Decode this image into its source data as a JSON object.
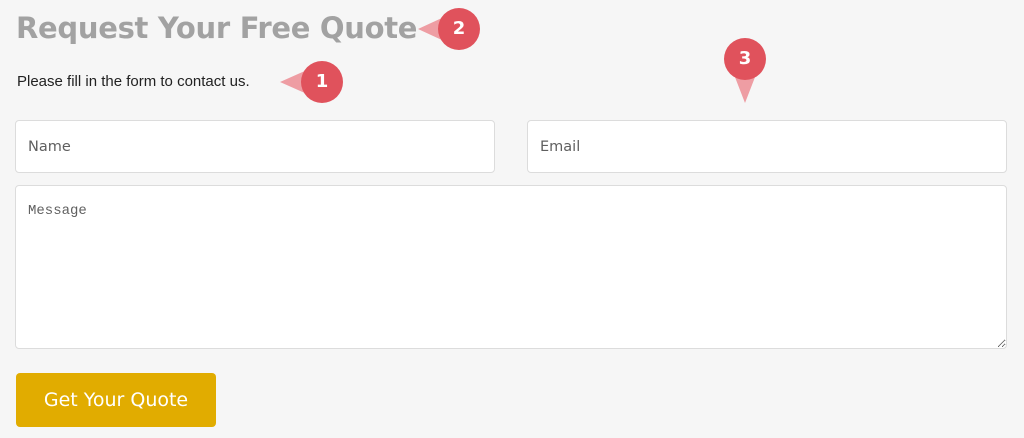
{
  "form": {
    "title": "Request Your Free Quote",
    "subtitle": "Please fill in the form to contact us.",
    "name_placeholder": "Name",
    "email_placeholder": "Email",
    "message_placeholder": "Message",
    "submit_label": "Get Your Quote"
  },
  "annotations": [
    {
      "number": "1"
    },
    {
      "number": "2"
    },
    {
      "number": "3"
    }
  ],
  "colors": {
    "background": "#f6f6f6",
    "title": "#a2a2a2",
    "button": "#e1ac00",
    "marker": "#e0525c",
    "marker_pointer": "#ee9da3"
  }
}
